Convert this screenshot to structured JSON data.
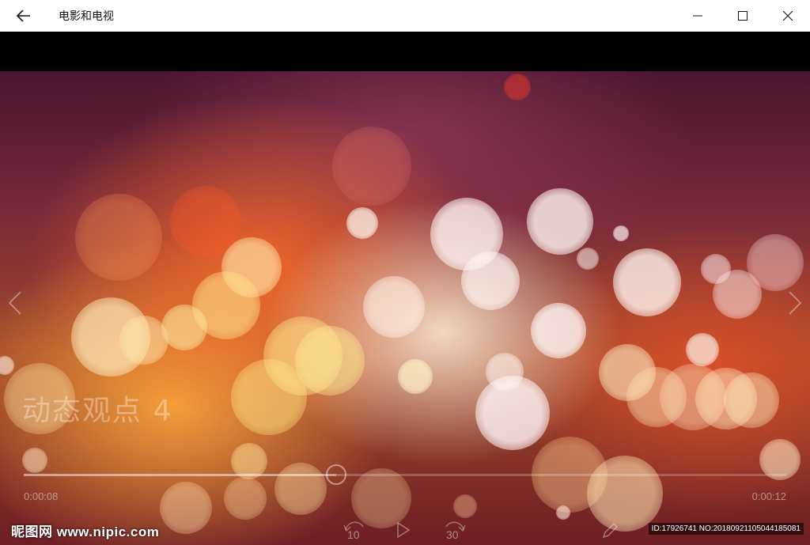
{
  "window": {
    "title": "电影和电视",
    "back_icon": "arrow-left-icon",
    "minimize_icon": "minimize-icon",
    "maximize_icon": "maximize-icon",
    "close_icon": "close-icon"
  },
  "video": {
    "overlay_title": "动态观点 4",
    "prev_icon": "chevron-left-icon",
    "next_icon": "chevron-right-icon"
  },
  "transport": {
    "elapsed": "0:00:08",
    "total": "0:00:12",
    "progress": 0.41,
    "skip_back_label": "10",
    "skip_forward_label": "30",
    "play_icon": "play-icon",
    "edit_icon": "pencil-icon"
  },
  "watermark": {
    "logo_text": "昵图网 www.nipic.com",
    "id_text": "ID:17926741 NO:20180921105044185081"
  },
  "colors": {
    "titlebar_bg": "#ffffff",
    "letterbox": "#000000"
  }
}
